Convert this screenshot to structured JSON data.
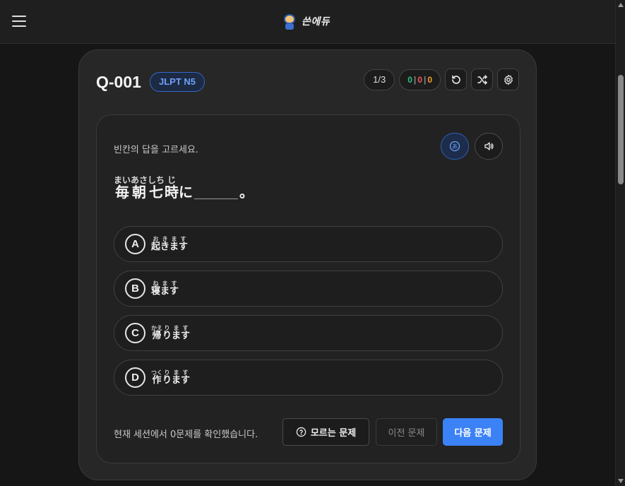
{
  "header": {
    "brand": "쓴에듀",
    "menu_icon": "hamburger-menu-icon",
    "logo_icon": "mascot-logo-icon"
  },
  "card": {
    "question_id": "Q-001",
    "level_badge": "JLPT N5",
    "progress": "1/3",
    "score": {
      "correct": "0",
      "wrong": "0",
      "unknown": "0"
    },
    "icons": [
      "reset-icon",
      "shuffle-icon",
      "settings-icon"
    ]
  },
  "quiz": {
    "instruction": "빈칸의 답을 고르세요.",
    "furigana_toggle_label": "あ",
    "question": {
      "segments": [
        {
          "text": "毎",
          "reading": "まい"
        },
        {
          "text": "朝",
          "reading": "あさ"
        },
        {
          "text": "七",
          "reading": "しち"
        },
        {
          "text": "時",
          "reading": "じ"
        },
        {
          "text": "に",
          "reading": ""
        }
      ],
      "ending": "。"
    },
    "options": [
      {
        "letter": "A",
        "kanji": "起",
        "reading": "お",
        "rest": "きます",
        "rest_reading": "きます"
      },
      {
        "letter": "B",
        "kanji": "寝",
        "reading": "ね",
        "rest": "ます",
        "rest_reading": "ます"
      },
      {
        "letter": "C",
        "kanji": "帰",
        "reading": "かえ",
        "rest": "ります",
        "rest_reading": "ります"
      },
      {
        "letter": "D",
        "kanji": "作",
        "reading": "つく",
        "rest": "ります",
        "rest_reading": "ります"
      }
    ]
  },
  "footer": {
    "session_note": "현재 세션에서 0문제를 확인했습니다.",
    "unknown_button": "모르는 문제",
    "prev_button": "이전 문제",
    "next_button": "다음 문제"
  },
  "colors": {
    "accent": "#3b82f6",
    "correct": "#2ec27e",
    "wrong": "#ef5b5b",
    "unknown": "#f0a030"
  }
}
